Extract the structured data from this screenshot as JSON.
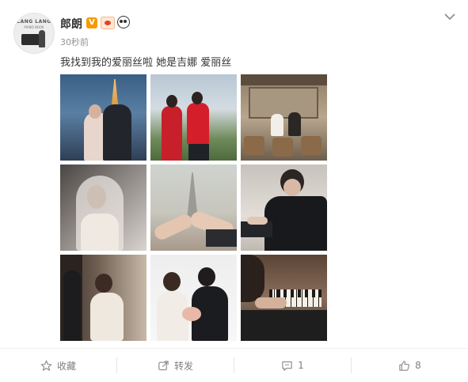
{
  "post": {
    "author": "郎朗",
    "verified_badge": "V",
    "time": "30秒前",
    "text": "我找到我的爱丽丝啦 她是吉娜 爱丽丝",
    "avatar": {
      "brand": "LANG LANG",
      "sub": "PIANO BOOK"
    },
    "photos": [
      "eiffel-tower-night-couple",
      "red-qipao-couple",
      "paris-cafe-couple",
      "bridal-veil-portrait",
      "pinky-promise-eiffel",
      "pianist-close-up",
      "bride-doorway",
      "wedding-couple-bouquet",
      "piano-keys-hands"
    ]
  },
  "actions": {
    "favorite": "收藏",
    "repost": "转发",
    "comments": "1",
    "likes": "8"
  },
  "colors": {
    "accent": "#f79b00",
    "text": "#333333",
    "muted": "#939393"
  }
}
